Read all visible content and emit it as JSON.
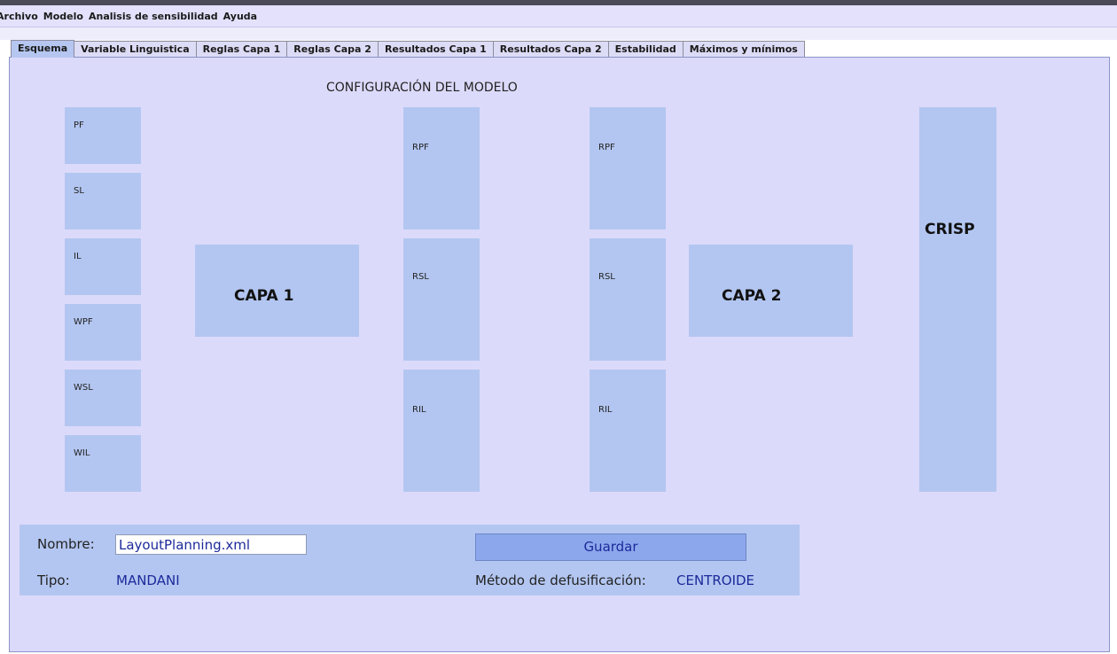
{
  "menu": [
    "Archivo",
    "Modelo",
    "Analisis de sensibilidad",
    "Ayuda"
  ],
  "tabs": [
    "Esquema",
    "Variable Linguistica",
    "Reglas Capa 1",
    "Reglas Capa 2",
    "Resultados Capa 1",
    "Resultados Capa 2",
    "Estabilidad",
    "Máximos y mínimos"
  ],
  "active_tab": "Esquema",
  "diagram": {
    "title": "CONFIGURACIÓN DEL MODELO",
    "inputs": [
      "PF",
      "SL",
      "IL",
      "WPF",
      "WSL",
      "WIL"
    ],
    "layer1": "CAPA 1",
    "rules1": [
      "RPF",
      "RSL",
      "RIL"
    ],
    "rules2": [
      "RPF",
      "RSL",
      "RIL"
    ],
    "layer2": "CAPA 2",
    "output": "CRISP"
  },
  "form": {
    "nombre_label": "Nombre:",
    "nombre_value": "LayoutPlanning.xml",
    "tipo_label": "Tipo:",
    "tipo_value": "MANDANI",
    "guardar": "Guardar",
    "metodo_label": "Método de defusificación:",
    "metodo_value": "CENTROIDE"
  }
}
